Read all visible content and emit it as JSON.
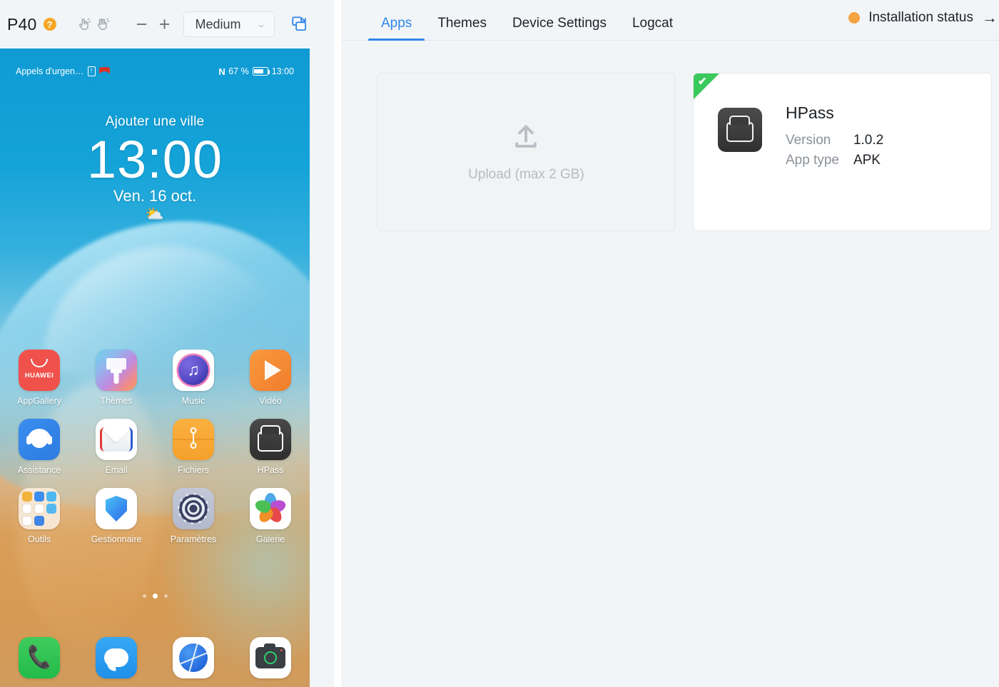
{
  "device_toolbar": {
    "device_name": "P40",
    "help_badge": "?",
    "tap_icon": "hand-tap-icon",
    "swipe_icon": "hand-swipe-icon",
    "zoom_out": "−",
    "zoom_in": "+",
    "size_value": "Medium",
    "size_chevron": "⌄",
    "popout_icon": "popout-window-icon"
  },
  "phone": {
    "status_bar": {
      "carrier": "Appels d'urgen…",
      "sim_icon": "sim-card-alert-icon",
      "brand_icon": "huawei-logo-icon",
      "nfc": "N",
      "battery_percent": "67 %",
      "battery_icon": "battery-icon",
      "time": "13:00"
    },
    "clock_widget": {
      "city": "Ajouter une ville",
      "time": "13:00",
      "date": "Ven. 16 oct.",
      "weather_glyph": "⛅"
    },
    "app_rows": [
      [
        {
          "label": "AppGallery",
          "icon": "appgallery-icon",
          "brand": "HUAWEI"
        },
        {
          "label": "Thèmes",
          "icon": "themes-icon"
        },
        {
          "label": "Music",
          "icon": "music-icon"
        },
        {
          "label": "Vidéo",
          "icon": "video-icon"
        }
      ],
      [
        {
          "label": "Assistance",
          "icon": "assistance-icon"
        },
        {
          "label": "Email",
          "icon": "email-icon"
        },
        {
          "label": "Fichiers",
          "icon": "files-icon"
        },
        {
          "label": "HPass",
          "icon": "hpass-icon"
        }
      ],
      [
        {
          "label": "Outils",
          "icon": "tools-folder-icon"
        },
        {
          "label": "Gestionnaire",
          "icon": "manager-shield-icon"
        },
        {
          "label": "Paramètres",
          "icon": "settings-gear-icon"
        },
        {
          "label": "Galerie",
          "icon": "gallery-flower-icon"
        }
      ]
    ],
    "page_dots": {
      "count": 3,
      "active_index": 1
    },
    "dock": [
      {
        "label": "",
        "icon": "phone-icon"
      },
      {
        "label": "",
        "icon": "messages-icon"
      },
      {
        "label": "",
        "icon": "browser-globe-icon"
      },
      {
        "label": "",
        "icon": "camera-icon"
      }
    ]
  },
  "main": {
    "tabs": [
      {
        "label": "Apps",
        "active": true
      },
      {
        "label": "Themes",
        "active": false
      },
      {
        "label": "Device Settings",
        "active": false
      },
      {
        "label": "Logcat",
        "active": false
      }
    ],
    "installation_status": {
      "label": "Installation status",
      "arrow": "→",
      "dot_color": "#f5a340"
    },
    "upload_card": {
      "label": "Upload (max 2 GB)",
      "icon": "upload-icon"
    },
    "app_card": {
      "name": "HPass",
      "icon": "hpass-icon",
      "installed_check": "✔",
      "fields": [
        {
          "key": "Version",
          "value": "1.0.2"
        },
        {
          "key": "App type",
          "value": "APK"
        }
      ]
    }
  },
  "colors": {
    "accent": "#2f86e8",
    "status_orange": "#f5a340",
    "success_green": "#39c95c",
    "page_bg": "#f1f5f8"
  }
}
